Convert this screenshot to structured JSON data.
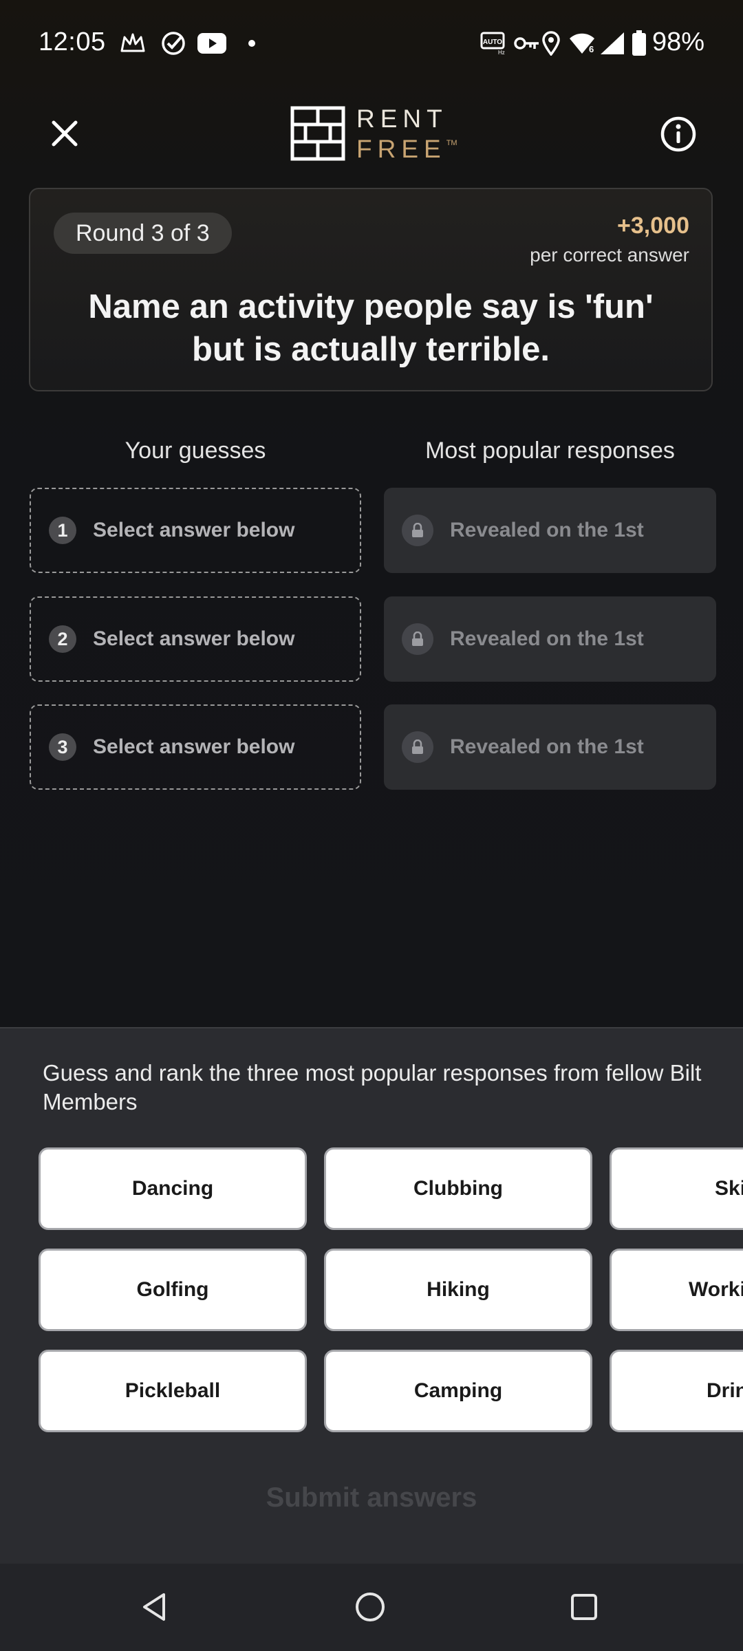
{
  "status_bar": {
    "time": "12:05",
    "battery": "98%",
    "icons": [
      "crown-icon",
      "check-circle-icon",
      "youtube-icon",
      "dot-icon",
      "auto-hz-icon",
      "key-icon",
      "location-icon",
      "wifi-icon",
      "signal-icon",
      "battery-icon"
    ]
  },
  "header": {
    "logo_line1": "RENT",
    "logo_line2": "FREE",
    "logo_tm": "TM"
  },
  "question": {
    "round": "Round 3 of 3",
    "points": "+3,000",
    "points_caption": "per correct answer",
    "text": "Name an activity people say is 'fun' but is actually terrible."
  },
  "columns": {
    "guesses_header": "Your guesses",
    "popular_header": "Most popular responses"
  },
  "guesses": [
    {
      "number": "1",
      "label": "Select answer below"
    },
    {
      "number": "2",
      "label": "Select answer below"
    },
    {
      "number": "3",
      "label": "Select answer below"
    }
  ],
  "responses": [
    {
      "label": "Revealed on the 1st"
    },
    {
      "label": "Revealed on the 1st"
    },
    {
      "label": "Revealed on the 1st"
    }
  ],
  "sheet": {
    "instructions": "Guess and rank the three most popular responses from fellow Bilt Members",
    "options": [
      [
        "Dancing",
        "Clubbing",
        "Ski"
      ],
      [
        "Golfing",
        "Hiking",
        "Workin"
      ],
      [
        "Pickleball",
        "Camping",
        "Drin"
      ]
    ],
    "submit": "Submit answers"
  },
  "colors": {
    "accent_gold": "#c8a472",
    "points_gold": "#e6c08c",
    "background": "#141518",
    "sheet": "#2b2c30"
  }
}
